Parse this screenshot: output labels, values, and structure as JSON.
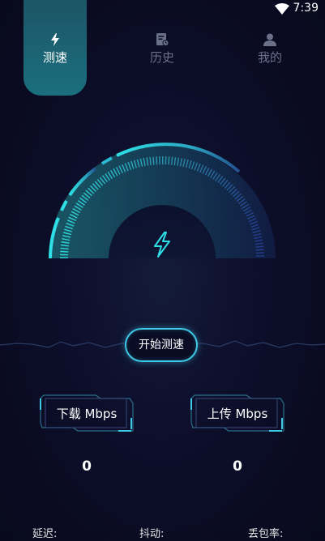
{
  "status_bar": {
    "time": "7:39",
    "wifi_icon": "wifi-icon"
  },
  "tabs": [
    {
      "label": "测速",
      "icon": "bolt-icon",
      "active": true
    },
    {
      "label": "历史",
      "icon": "history-icon",
      "active": false
    },
    {
      "label": "我的",
      "icon": "user-icon",
      "active": false
    }
  ],
  "gauge": {
    "center_icon": "bolt-icon",
    "accent": "#2fe0e6"
  },
  "start_button": {
    "label": "开始测速"
  },
  "download": {
    "label": "下载 Mbps",
    "value": "0"
  },
  "upload": {
    "label": "上传 Mbps",
    "value": "0"
  },
  "bottom_stats": [
    "延迟:",
    "抖动:",
    "丢包率:"
  ],
  "colors": {
    "accent": "#3fc8e6",
    "tab_active": "#1b6f7e",
    "background": "#0d0f2b"
  }
}
